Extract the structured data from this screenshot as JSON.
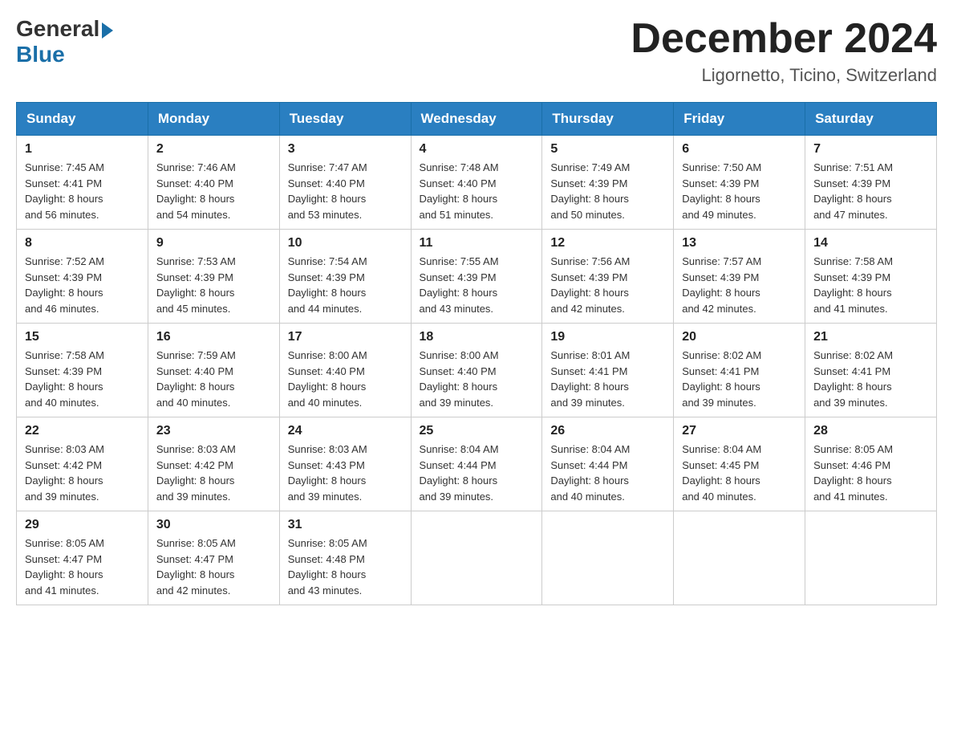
{
  "header": {
    "logo_general": "General",
    "logo_blue": "Blue",
    "month_title": "December 2024",
    "location": "Ligornetto, Ticino, Switzerland"
  },
  "weekdays": [
    "Sunday",
    "Monday",
    "Tuesday",
    "Wednesday",
    "Thursday",
    "Friday",
    "Saturday"
  ],
  "weeks": [
    [
      {
        "day": "1",
        "sunrise": "7:45 AM",
        "sunset": "4:41 PM",
        "daylight": "8 hours and 56 minutes."
      },
      {
        "day": "2",
        "sunrise": "7:46 AM",
        "sunset": "4:40 PM",
        "daylight": "8 hours and 54 minutes."
      },
      {
        "day": "3",
        "sunrise": "7:47 AM",
        "sunset": "4:40 PM",
        "daylight": "8 hours and 53 minutes."
      },
      {
        "day": "4",
        "sunrise": "7:48 AM",
        "sunset": "4:40 PM",
        "daylight": "8 hours and 51 minutes."
      },
      {
        "day": "5",
        "sunrise": "7:49 AM",
        "sunset": "4:39 PM",
        "daylight": "8 hours and 50 minutes."
      },
      {
        "day": "6",
        "sunrise": "7:50 AM",
        "sunset": "4:39 PM",
        "daylight": "8 hours and 49 minutes."
      },
      {
        "day": "7",
        "sunrise": "7:51 AM",
        "sunset": "4:39 PM",
        "daylight": "8 hours and 47 minutes."
      }
    ],
    [
      {
        "day": "8",
        "sunrise": "7:52 AM",
        "sunset": "4:39 PM",
        "daylight": "8 hours and 46 minutes."
      },
      {
        "day": "9",
        "sunrise": "7:53 AM",
        "sunset": "4:39 PM",
        "daylight": "8 hours and 45 minutes."
      },
      {
        "day": "10",
        "sunrise": "7:54 AM",
        "sunset": "4:39 PM",
        "daylight": "8 hours and 44 minutes."
      },
      {
        "day": "11",
        "sunrise": "7:55 AM",
        "sunset": "4:39 PM",
        "daylight": "8 hours and 43 minutes."
      },
      {
        "day": "12",
        "sunrise": "7:56 AM",
        "sunset": "4:39 PM",
        "daylight": "8 hours and 42 minutes."
      },
      {
        "day": "13",
        "sunrise": "7:57 AM",
        "sunset": "4:39 PM",
        "daylight": "8 hours and 42 minutes."
      },
      {
        "day": "14",
        "sunrise": "7:58 AM",
        "sunset": "4:39 PM",
        "daylight": "8 hours and 41 minutes."
      }
    ],
    [
      {
        "day": "15",
        "sunrise": "7:58 AM",
        "sunset": "4:39 PM",
        "daylight": "8 hours and 40 minutes."
      },
      {
        "day": "16",
        "sunrise": "7:59 AM",
        "sunset": "4:40 PM",
        "daylight": "8 hours and 40 minutes."
      },
      {
        "day": "17",
        "sunrise": "8:00 AM",
        "sunset": "4:40 PM",
        "daylight": "8 hours and 40 minutes."
      },
      {
        "day": "18",
        "sunrise": "8:00 AM",
        "sunset": "4:40 PM",
        "daylight": "8 hours and 39 minutes."
      },
      {
        "day": "19",
        "sunrise": "8:01 AM",
        "sunset": "4:41 PM",
        "daylight": "8 hours and 39 minutes."
      },
      {
        "day": "20",
        "sunrise": "8:02 AM",
        "sunset": "4:41 PM",
        "daylight": "8 hours and 39 minutes."
      },
      {
        "day": "21",
        "sunrise": "8:02 AM",
        "sunset": "4:41 PM",
        "daylight": "8 hours and 39 minutes."
      }
    ],
    [
      {
        "day": "22",
        "sunrise": "8:03 AM",
        "sunset": "4:42 PM",
        "daylight": "8 hours and 39 minutes."
      },
      {
        "day": "23",
        "sunrise": "8:03 AM",
        "sunset": "4:42 PM",
        "daylight": "8 hours and 39 minutes."
      },
      {
        "day": "24",
        "sunrise": "8:03 AM",
        "sunset": "4:43 PM",
        "daylight": "8 hours and 39 minutes."
      },
      {
        "day": "25",
        "sunrise": "8:04 AM",
        "sunset": "4:44 PM",
        "daylight": "8 hours and 39 minutes."
      },
      {
        "day": "26",
        "sunrise": "8:04 AM",
        "sunset": "4:44 PM",
        "daylight": "8 hours and 40 minutes."
      },
      {
        "day": "27",
        "sunrise": "8:04 AM",
        "sunset": "4:45 PM",
        "daylight": "8 hours and 40 minutes."
      },
      {
        "day": "28",
        "sunrise": "8:05 AM",
        "sunset": "4:46 PM",
        "daylight": "8 hours and 41 minutes."
      }
    ],
    [
      {
        "day": "29",
        "sunrise": "8:05 AM",
        "sunset": "4:47 PM",
        "daylight": "8 hours and 41 minutes."
      },
      {
        "day": "30",
        "sunrise": "8:05 AM",
        "sunset": "4:47 PM",
        "daylight": "8 hours and 42 minutes."
      },
      {
        "day": "31",
        "sunrise": "8:05 AM",
        "sunset": "4:48 PM",
        "daylight": "8 hours and 43 minutes."
      },
      null,
      null,
      null,
      null
    ]
  ]
}
